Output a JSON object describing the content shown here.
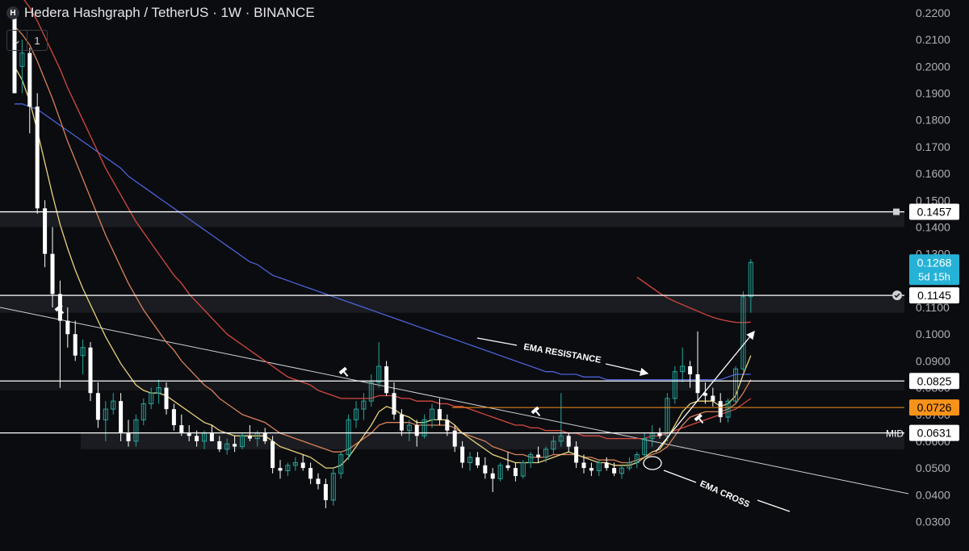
{
  "header": {
    "logo_letter": "H",
    "title": "Hedera Hashgraph / TetherUS · 1W · BINANCE",
    "collapse_label": "⌄",
    "count_label": "1"
  },
  "colors": {
    "background": "#0b0c10",
    "up": "#26a69a",
    "down": "#ffffff",
    "ema_yellow": "#e8d27a",
    "ema_orange": "#d9825b",
    "ema_red": "#d5493f",
    "ema_blue": "#4a63d6",
    "level_line": "#ffffff",
    "current_price": "#26b2d6",
    "orange_level": "#f7931a"
  },
  "chart_data": {
    "type": "candlestick",
    "ylim": [
      0.03,
      0.225
    ],
    "y_ticks": [
      "0.0300",
      "0.0400",
      "0.0500",
      "0.0600",
      "0.0700",
      "0.0800",
      "0.0900",
      "0.1000",
      "0.1100",
      "0.1200",
      "0.1300",
      "0.1400",
      "0.1500",
      "0.1600",
      "0.1700",
      "0.1800",
      "0.1900",
      "0.2000",
      "0.2100",
      "0.2200"
    ],
    "candles": [
      [
        0.218,
        0.22,
        0.19,
        0.19
      ],
      [
        0.2,
        0.21,
        0.19,
        0.205
      ],
      [
        0.205,
        0.207,
        0.175,
        0.185
      ],
      [
        0.185,
        0.19,
        0.145,
        0.147
      ],
      [
        0.147,
        0.15,
        0.125,
        0.13
      ],
      [
        0.13,
        0.14,
        0.11,
        0.115
      ],
      [
        0.115,
        0.12,
        0.08,
        0.105
      ],
      [
        0.105,
        0.11,
        0.095,
        0.1
      ],
      [
        0.1,
        0.105,
        0.09,
        0.092
      ],
      [
        0.092,
        0.098,
        0.085,
        0.095
      ],
      [
        0.095,
        0.097,
        0.075,
        0.078
      ],
      [
        0.078,
        0.082,
        0.065,
        0.068
      ],
      [
        0.068,
        0.075,
        0.06,
        0.072
      ],
      [
        0.072,
        0.078,
        0.07,
        0.075
      ],
      [
        0.075,
        0.078,
        0.06,
        0.063
      ],
      [
        0.063,
        0.068,
        0.058,
        0.06
      ],
      [
        0.06,
        0.07,
        0.058,
        0.068
      ],
      [
        0.068,
        0.076,
        0.066,
        0.074
      ],
      [
        0.074,
        0.08,
        0.072,
        0.078
      ],
      [
        0.078,
        0.083,
        0.074,
        0.08
      ],
      [
        0.08,
        0.082,
        0.07,
        0.072
      ],
      [
        0.072,
        0.074,
        0.064,
        0.066
      ],
      [
        0.066,
        0.07,
        0.062,
        0.063
      ],
      [
        0.063,
        0.066,
        0.06,
        0.062
      ],
      [
        0.062,
        0.064,
        0.058,
        0.06
      ],
      [
        0.06,
        0.064,
        0.057,
        0.063
      ],
      [
        0.063,
        0.066,
        0.06,
        0.06
      ],
      [
        0.06,
        0.062,
        0.056,
        0.057
      ],
      [
        0.057,
        0.061,
        0.055,
        0.059
      ],
      [
        0.059,
        0.062,
        0.056,
        0.058
      ],
      [
        0.058,
        0.063,
        0.057,
        0.062
      ],
      [
        0.062,
        0.066,
        0.06,
        0.061
      ],
      [
        0.061,
        0.064,
        0.058,
        0.063
      ],
      [
        0.063,
        0.065,
        0.059,
        0.06
      ],
      [
        0.06,
        0.062,
        0.048,
        0.05
      ],
      [
        0.05,
        0.053,
        0.046,
        0.049
      ],
      [
        0.049,
        0.052,
        0.047,
        0.051
      ],
      [
        0.051,
        0.054,
        0.049,
        0.052
      ],
      [
        0.052,
        0.055,
        0.049,
        0.05
      ],
      [
        0.05,
        0.052,
        0.044,
        0.046
      ],
      [
        0.046,
        0.048,
        0.042,
        0.044
      ],
      [
        0.044,
        0.046,
        0.035,
        0.038
      ],
      [
        0.038,
        0.05,
        0.036,
        0.048
      ],
      [
        0.048,
        0.056,
        0.046,
        0.055
      ],
      [
        0.055,
        0.07,
        0.053,
        0.068
      ],
      [
        0.068,
        0.075,
        0.065,
        0.072
      ],
      [
        0.072,
        0.078,
        0.068,
        0.075
      ],
      [
        0.075,
        0.085,
        0.073,
        0.082
      ],
      [
        0.082,
        0.097,
        0.08,
        0.088
      ],
      [
        0.088,
        0.09,
        0.077,
        0.078
      ],
      [
        0.078,
        0.082,
        0.068,
        0.07
      ],
      [
        0.07,
        0.072,
        0.062,
        0.064
      ],
      [
        0.064,
        0.068,
        0.06,
        0.066
      ],
      [
        0.066,
        0.068,
        0.058,
        0.062
      ],
      [
        0.062,
        0.07,
        0.061,
        0.068
      ],
      [
        0.068,
        0.074,
        0.065,
        0.072
      ],
      [
        0.072,
        0.076,
        0.066,
        0.068
      ],
      [
        0.068,
        0.07,
        0.062,
        0.064
      ],
      [
        0.064,
        0.066,
        0.056,
        0.058
      ],
      [
        0.058,
        0.06,
        0.05,
        0.052
      ],
      [
        0.052,
        0.056,
        0.049,
        0.054
      ],
      [
        0.054,
        0.056,
        0.05,
        0.051
      ],
      [
        0.051,
        0.054,
        0.046,
        0.048
      ],
      [
        0.048,
        0.05,
        0.041,
        0.046
      ],
      [
        0.046,
        0.052,
        0.045,
        0.051
      ],
      [
        0.051,
        0.056,
        0.049,
        0.05
      ],
      [
        0.05,
        0.052,
        0.045,
        0.047
      ],
      [
        0.047,
        0.053,
        0.046,
        0.052
      ],
      [
        0.052,
        0.056,
        0.05,
        0.055
      ],
      [
        0.055,
        0.058,
        0.052,
        0.054
      ],
      [
        0.054,
        0.058,
        0.052,
        0.057
      ],
      [
        0.057,
        0.062,
        0.055,
        0.06
      ],
      [
        0.06,
        0.078,
        0.058,
        0.062
      ],
      [
        0.062,
        0.063,
        0.056,
        0.058
      ],
      [
        0.058,
        0.06,
        0.05,
        0.052
      ],
      [
        0.052,
        0.055,
        0.048,
        0.05
      ],
      [
        0.05,
        0.052,
        0.047,
        0.049
      ],
      [
        0.049,
        0.053,
        0.047,
        0.052
      ],
      [
        0.052,
        0.054,
        0.049,
        0.05
      ],
      [
        0.05,
        0.052,
        0.047,
        0.048
      ],
      [
        0.048,
        0.051,
        0.046,
        0.05
      ],
      [
        0.05,
        0.054,
        0.049,
        0.052
      ],
      [
        0.052,
        0.056,
        0.05,
        0.055
      ],
      [
        0.055,
        0.063,
        0.054,
        0.061
      ],
      [
        0.061,
        0.066,
        0.058,
        0.063
      ],
      [
        0.063,
        0.065,
        0.061,
        0.062
      ],
      [
        0.062,
        0.078,
        0.06,
        0.076
      ],
      [
        0.076,
        0.088,
        0.074,
        0.086
      ],
      [
        0.086,
        0.095,
        0.082,
        0.088
      ],
      [
        0.088,
        0.09,
        0.08,
        0.085
      ],
      [
        0.085,
        0.101,
        0.075,
        0.078
      ],
      [
        0.078,
        0.082,
        0.074,
        0.077
      ],
      [
        0.077,
        0.08,
        0.073,
        0.075
      ],
      [
        0.075,
        0.078,
        0.067,
        0.069
      ],
      [
        0.069,
        0.076,
        0.067,
        0.075
      ],
      [
        0.075,
        0.088,
        0.074,
        0.087
      ],
      [
        0.087,
        0.116,
        0.086,
        0.114
      ],
      [
        0.114,
        0.128,
        0.108,
        0.1268
      ]
    ],
    "ema_fast": [
      0.2,
      0.195,
      0.187,
      0.176,
      0.164,
      0.152,
      0.141,
      0.132,
      0.124,
      0.117,
      0.111,
      0.105,
      0.099,
      0.094,
      0.089,
      0.085,
      0.081,
      0.079,
      0.078,
      0.078,
      0.077,
      0.075,
      0.073,
      0.071,
      0.069,
      0.067,
      0.066,
      0.064,
      0.063,
      0.062,
      0.062,
      0.062,
      0.062,
      0.062,
      0.06,
      0.058,
      0.057,
      0.056,
      0.055,
      0.054,
      0.052,
      0.05,
      0.05,
      0.051,
      0.054,
      0.058,
      0.062,
      0.066,
      0.071,
      0.073,
      0.072,
      0.07,
      0.069,
      0.067,
      0.067,
      0.068,
      0.068,
      0.068,
      0.066,
      0.063,
      0.061,
      0.059,
      0.057,
      0.055,
      0.054,
      0.053,
      0.052,
      0.052,
      0.052,
      0.052,
      0.053,
      0.054,
      0.055,
      0.056,
      0.055,
      0.054,
      0.053,
      0.052,
      0.052,
      0.051,
      0.051,
      0.051,
      0.052,
      0.054,
      0.056,
      0.057,
      0.061,
      0.066,
      0.071,
      0.074,
      0.075,
      0.075,
      0.075,
      0.073,
      0.074,
      0.077,
      0.085,
      0.092
    ],
    "ema_mid": [
      0.215,
      0.212,
      0.208,
      0.202,
      0.195,
      0.188,
      0.18,
      0.172,
      0.165,
      0.158,
      0.151,
      0.144,
      0.137,
      0.131,
      0.125,
      0.119,
      0.114,
      0.109,
      0.105,
      0.101,
      0.097,
      0.094,
      0.09,
      0.087,
      0.084,
      0.081,
      0.079,
      0.076,
      0.074,
      0.072,
      0.07,
      0.069,
      0.068,
      0.067,
      0.065,
      0.063,
      0.062,
      0.061,
      0.06,
      0.059,
      0.058,
      0.057,
      0.056,
      0.056,
      0.057,
      0.059,
      0.061,
      0.063,
      0.066,
      0.067,
      0.067,
      0.067,
      0.067,
      0.066,
      0.066,
      0.066,
      0.066,
      0.066,
      0.065,
      0.063,
      0.062,
      0.061,
      0.06,
      0.058,
      0.057,
      0.056,
      0.055,
      0.055,
      0.054,
      0.054,
      0.054,
      0.055,
      0.055,
      0.055,
      0.055,
      0.054,
      0.054,
      0.053,
      0.053,
      0.053,
      0.052,
      0.052,
      0.053,
      0.054,
      0.055,
      0.056,
      0.058,
      0.062,
      0.066,
      0.069,
      0.07,
      0.071,
      0.071,
      0.071,
      0.072,
      0.074,
      0.078,
      0.083
    ],
    "ema_slow_red": [
      0.23,
      0.226,
      0.222,
      0.217,
      0.211,
      0.205,
      0.199,
      0.192,
      0.186,
      0.18,
      0.174,
      0.168,
      0.162,
      0.157,
      0.152,
      0.147,
      0.142,
      0.138,
      0.134,
      0.13,
      0.126,
      0.122,
      0.119,
      0.115,
      0.112,
      0.109,
      0.106,
      0.103,
      0.1,
      0.098,
      0.096,
      0.094,
      0.092,
      0.09,
      0.088,
      0.086,
      0.084,
      0.083,
      0.082,
      0.081,
      0.079,
      0.078,
      0.077,
      0.076,
      0.076,
      0.076,
      0.076,
      0.076,
      0.077,
      0.077,
      0.077,
      0.076,
      0.076,
      0.075,
      0.075,
      0.075,
      0.074,
      0.074,
      0.073,
      0.073,
      0.072,
      0.071,
      0.07,
      0.069,
      0.068,
      0.067,
      0.066,
      0.066,
      0.065,
      0.065,
      0.064,
      0.064,
      0.064,
      0.063,
      0.063,
      0.062,
      0.062,
      0.062,
      0.061,
      0.061,
      0.061,
      0.061,
      0.061,
      0.061,
      0.062,
      0.062,
      0.063,
      0.064,
      0.065,
      0.066,
      0.067,
      0.068,
      0.069,
      0.07,
      0.071,
      0.072,
      0.074,
      0.076
    ],
    "ema_blue": [
      0.186,
      0.186,
      0.185,
      0.184,
      0.182,
      0.18,
      0.178,
      0.176,
      0.174,
      0.172,
      0.17,
      0.168,
      0.166,
      0.164,
      0.162,
      0.159,
      0.157,
      0.155,
      0.153,
      0.151,
      0.149,
      0.147,
      0.145,
      0.143,
      0.141,
      0.139,
      0.137,
      0.135,
      0.133,
      0.131,
      0.129,
      0.127,
      0.126,
      0.124,
      0.122,
      0.121,
      0.12,
      0.119,
      0.118,
      0.117,
      0.116,
      0.115,
      0.114,
      0.113,
      0.112,
      0.111,
      0.11,
      0.109,
      0.108,
      0.107,
      0.106,
      0.105,
      0.104,
      0.103,
      0.102,
      0.101,
      0.1,
      0.099,
      0.098,
      0.097,
      0.096,
      0.095,
      0.094,
      0.093,
      0.092,
      0.091,
      0.09,
      0.089,
      0.088,
      0.087,
      0.086,
      0.086,
      0.085,
      0.085,
      0.085,
      0.084,
      0.084,
      0.084,
      0.083,
      0.083,
      0.083,
      0.083,
      0.083,
      0.083,
      0.083,
      0.083,
      0.083,
      0.083,
      0.083,
      0.083,
      0.083,
      0.083,
      0.083,
      0.083,
      0.084,
      0.085,
      0.085,
      0.085
    ],
    "ema_200_segment": [
      [
        0.1213,
        0.1193,
        0.1173,
        0.1153,
        0.1136,
        0.1122,
        0.111,
        0.1098,
        0.1086,
        0.1074,
        0.1063,
        0.1055,
        0.1049,
        0.1044,
        0.1043,
        0.1045
      ]
    ],
    "horizontal_levels": [
      {
        "value": 0.1457,
        "label": "0.1457"
      },
      {
        "value": 0.1145,
        "label": "0.1145"
      },
      {
        "value": 0.0825,
        "label": "0.0825"
      },
      {
        "value": 0.0631,
        "label": "0.0631",
        "tag": "MID"
      }
    ],
    "orange_level": {
      "value": 0.0726,
      "label": "0.0726"
    },
    "current_price": {
      "value": 0.1268,
      "label": "0.1268",
      "countdown": "5d 15h"
    },
    "annotations": [
      {
        "text": "EMA RESISTANCE"
      },
      {
        "text": "EMA CROSS"
      }
    ]
  }
}
